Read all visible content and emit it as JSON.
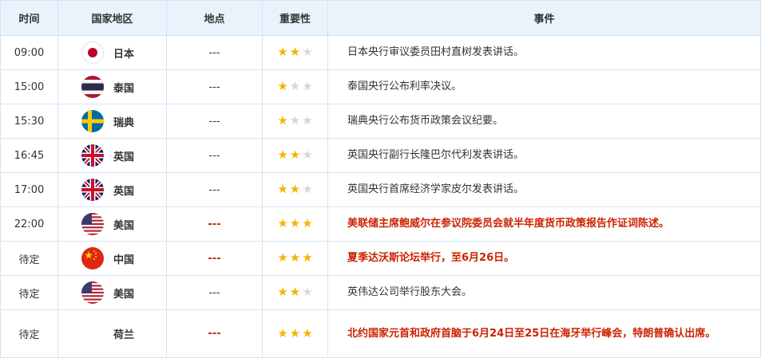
{
  "header": {
    "time": "时间",
    "country": "国家地区",
    "location": "地点",
    "importance": "重要性",
    "event": "事件"
  },
  "colors": {
    "hot": "#cc2200",
    "star_on": "#f5b400",
    "star_off": "#d6d6d6",
    "header_bg": "#eaf3fb",
    "border": "#d3e4f4"
  },
  "rows": [
    {
      "time": "09:00",
      "country": "日本",
      "flag": "japan-flag-icon",
      "location": "---",
      "stars": 2,
      "event": "日本央行审议委员田村直树发表讲话。",
      "hot": false
    },
    {
      "time": "15:00",
      "country": "泰国",
      "flag": "thailand-flag-icon",
      "location": "---",
      "stars": 1,
      "event": "泰国央行公布利率决议。",
      "hot": false
    },
    {
      "time": "15:30",
      "country": "瑞典",
      "flag": "sweden-flag-icon",
      "location": "---",
      "stars": 1,
      "event": "瑞典央行公布货币政策会议纪要。",
      "hot": false
    },
    {
      "time": "16:45",
      "country": "英国",
      "flag": "uk-flag-icon",
      "location": "---",
      "stars": 2,
      "event": "英国央行副行长隆巴尔代利发表讲话。",
      "hot": false
    },
    {
      "time": "17:00",
      "country": "英国",
      "flag": "uk-flag-icon",
      "location": "---",
      "stars": 2,
      "event": "英国央行首席经济学家皮尔发表讲话。",
      "hot": false
    },
    {
      "time": "22:00",
      "country": "美国",
      "flag": "usa-flag-icon",
      "location": "---",
      "stars": 3,
      "event": "美联储主席鲍威尔在参议院委员会就半年度货币政策报告作证词陈述。",
      "hot": true
    },
    {
      "time": "待定",
      "country": "中国",
      "flag": "china-flag-icon",
      "location": "---",
      "stars": 3,
      "event": "夏季达沃斯论坛举行，至6月26日。",
      "hot": true
    },
    {
      "time": "待定",
      "country": "美国",
      "flag": "usa-flag-icon",
      "location": "---",
      "stars": 2,
      "event": "英伟达公司举行股东大会。",
      "hot": false
    },
    {
      "time": "待定",
      "country": "荷兰",
      "flag": "",
      "location": "---",
      "stars": 3,
      "event": "北约国家元首和政府首脑于6月24日至25日在海牙举行峰会，特朗普确认出席。",
      "hot": true
    }
  ]
}
